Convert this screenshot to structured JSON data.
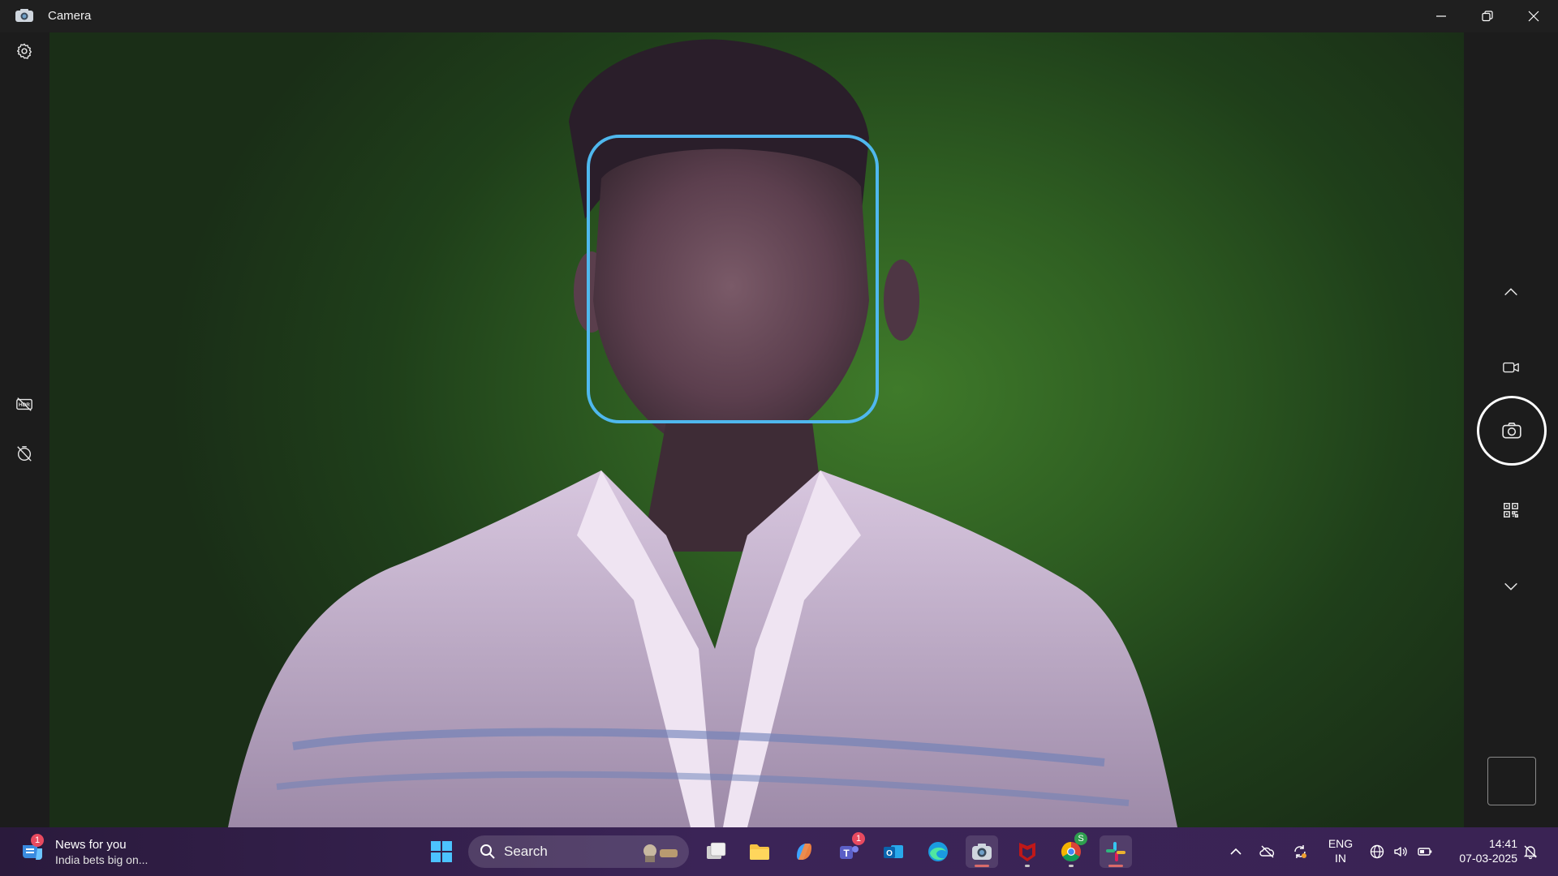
{
  "window": {
    "title": "Camera",
    "app_icon": "camera-app-icon",
    "controls": [
      "minimize-icon",
      "restore-icon",
      "close-icon"
    ]
  },
  "left_rail": {
    "items": [
      {
        "name": "settings",
        "icon": "gear-icon"
      },
      {
        "name": "hdr-off",
        "icon": "hdr-off-icon"
      },
      {
        "name": "timer-off",
        "icon": "timer-off-icon"
      }
    ]
  },
  "right_rail": {
    "items": [
      {
        "name": "scroll-up",
        "icon": "chevron-up-icon"
      },
      {
        "name": "video-mode",
        "icon": "video-camera-icon"
      },
      {
        "name": "photo-shutter",
        "icon": "camera-icon"
      },
      {
        "name": "qr-scan",
        "icon": "qr-code-icon"
      },
      {
        "name": "scroll-down",
        "icon": "chevron-down-icon"
      },
      {
        "name": "last-capture-thumbnail",
        "icon": "thumbnail"
      }
    ]
  },
  "preview": {
    "face_detection_color": "#4fb8ee"
  },
  "taskbar": {
    "news": {
      "title": "News for you",
      "subtitle": "India bets big on...",
      "badge": "1"
    },
    "search_placeholder": "Search",
    "apps": [
      {
        "name": "start",
        "icon": "windows-logo-icon"
      },
      {
        "name": "task-view",
        "icon": "task-view-icon"
      },
      {
        "name": "file-explorer",
        "icon": "folder-icon"
      },
      {
        "name": "copilot",
        "icon": "copilot-icon"
      },
      {
        "name": "teams",
        "icon": "teams-icon",
        "badge": "1"
      },
      {
        "name": "outlook",
        "icon": "outlook-icon"
      },
      {
        "name": "edge",
        "icon": "edge-icon"
      },
      {
        "name": "camera",
        "icon": "camera-app-icon",
        "active": true
      },
      {
        "name": "mcafee",
        "icon": "mcafee-icon"
      },
      {
        "name": "chrome",
        "icon": "chrome-icon",
        "badge": "S"
      },
      {
        "name": "slack",
        "icon": "slack-icon"
      }
    ],
    "tray": {
      "icons": [
        "chevron-up-icon",
        "onedrive-icon",
        "sync-icon",
        "globe-icon",
        "volume-icon",
        "battery-icon",
        "notification-icon"
      ],
      "lang_line1": "ENG",
      "lang_line2": "IN",
      "time": "14:41",
      "date": "07-03-2025"
    }
  }
}
